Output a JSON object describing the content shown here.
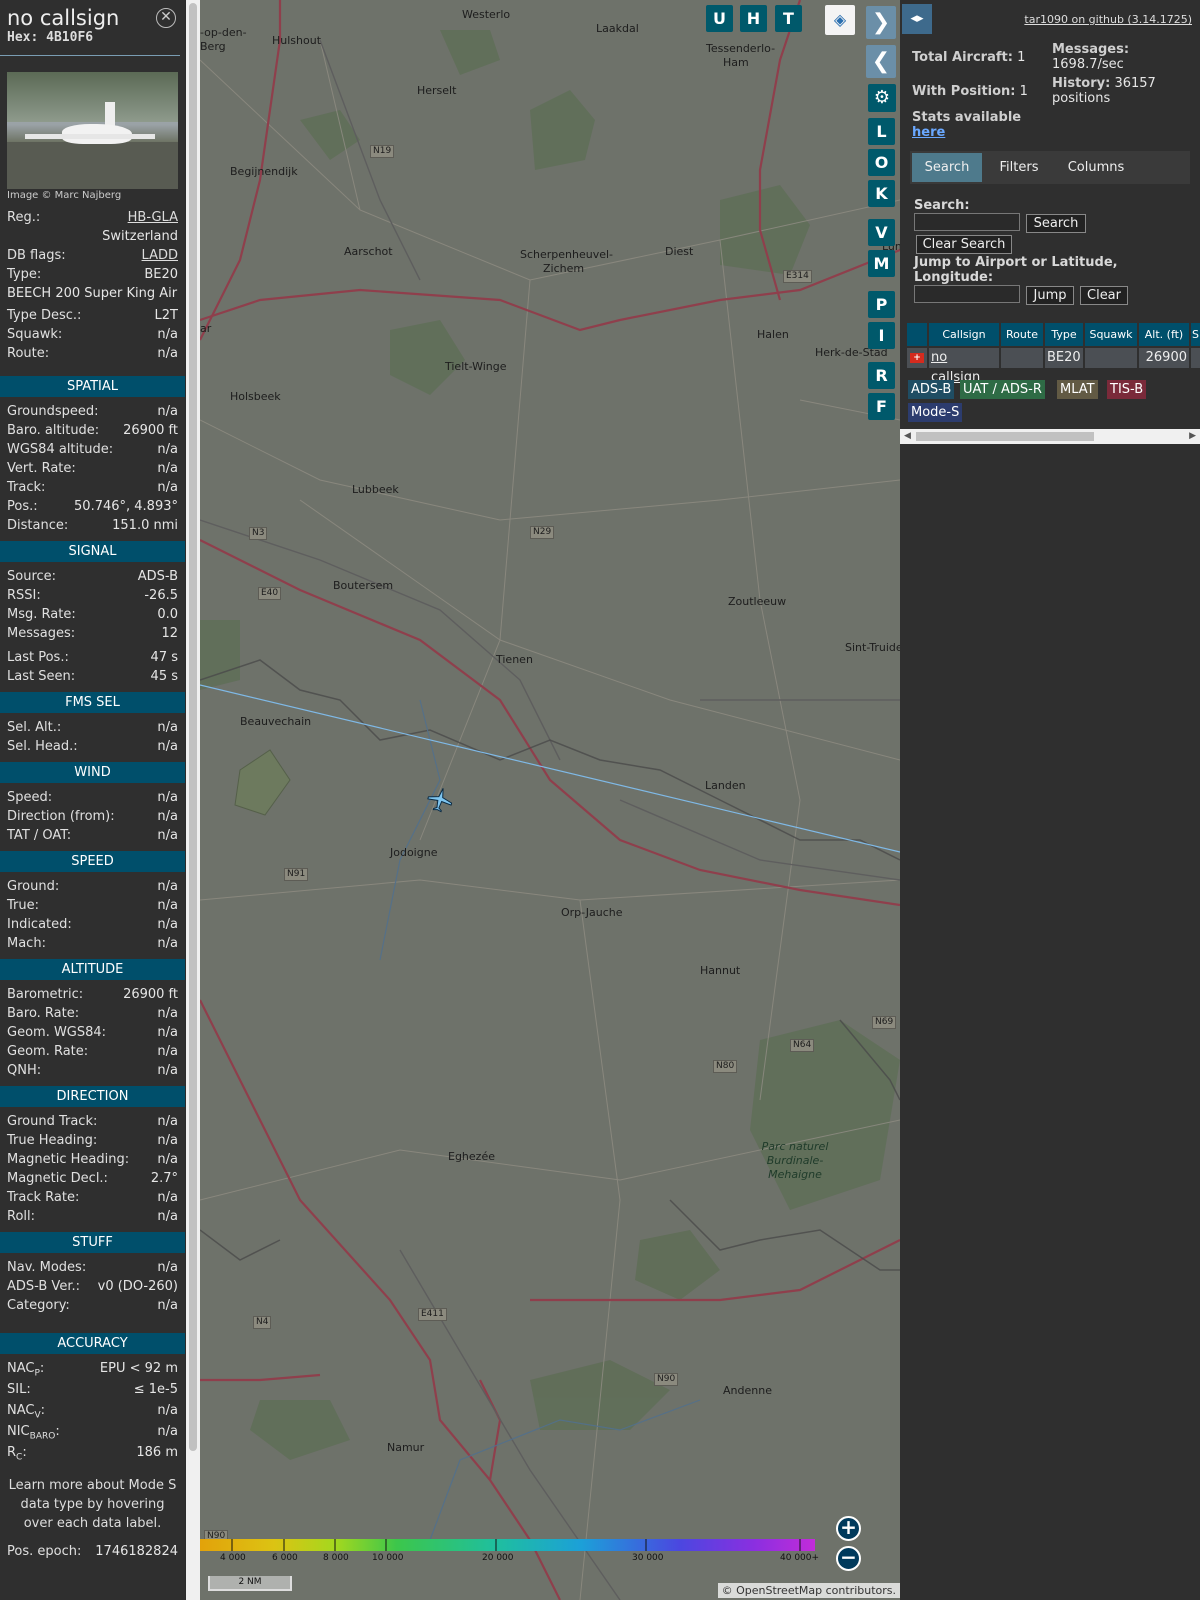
{
  "sidebar": {
    "callsign": "no callsign",
    "hex": "Hex: 4B10F6",
    "photo_credit": "Image © Marc Najberg",
    "reg_label": "Reg.:",
    "reg_value": "HB-GLA",
    "country": "Switzerland",
    "dbflags_label": "DB flags:",
    "dbflags_value": "LADD",
    "type_label": "Type:",
    "type_value": "BE20",
    "type_full": "BEECH 200 Super King Air",
    "typedesc_label": "Type Desc.:",
    "typedesc_value": "L2T",
    "squawk_label": "Squawk:",
    "squawk_value": "n/a",
    "route_label": "Route:",
    "route_value": "n/a",
    "sections": {
      "spatial": "SPATIAL",
      "signal": "SIGNAL",
      "fms": "FMS SEL",
      "wind": "WIND",
      "speed": "SPEED",
      "altitude": "ALTITUDE",
      "direction": "DIRECTION",
      "stuff": "STUFF",
      "accuracy": "ACCURACY"
    },
    "spatial": [
      {
        "k": "Groundspeed:",
        "v": "n/a"
      },
      {
        "k": "Baro. altitude:",
        "v": "26900 ft"
      },
      {
        "k": "WGS84 altitude:",
        "v": "n/a"
      },
      {
        "k": "Vert. Rate:",
        "v": "n/a"
      },
      {
        "k": "Track:",
        "v": "n/a"
      },
      {
        "k": "Pos.:",
        "v": "50.746°, 4.893°"
      },
      {
        "k": "Distance:",
        "v": "151.0 nmi"
      }
    ],
    "signal": [
      {
        "k": "Source:",
        "v": "ADS-B"
      },
      {
        "k": "RSSI:",
        "v": "-26.5"
      },
      {
        "k": "Msg. Rate:",
        "v": "0.0"
      },
      {
        "k": "Messages:",
        "v": "12"
      },
      {
        "k": "Last Pos.:",
        "v": "47 s"
      },
      {
        "k": "Last Seen:",
        "v": "45 s"
      }
    ],
    "fms": [
      {
        "k": "Sel. Alt.:",
        "v": "n/a"
      },
      {
        "k": "Sel. Head.:",
        "v": "n/a"
      }
    ],
    "wind": [
      {
        "k": "Speed:",
        "v": "n/a"
      },
      {
        "k": "Direction (from):",
        "v": "n/a"
      },
      {
        "k": "TAT / OAT:",
        "v": "n/a"
      }
    ],
    "speed": [
      {
        "k": "Ground:",
        "v": "n/a"
      },
      {
        "k": "True:",
        "v": "n/a"
      },
      {
        "k": "Indicated:",
        "v": "n/a"
      },
      {
        "k": "Mach:",
        "v": "n/a"
      }
    ],
    "altitude": [
      {
        "k": "Barometric:",
        "v": "26900 ft"
      },
      {
        "k": "Baro. Rate:",
        "v": "n/a"
      },
      {
        "k": "Geom. WGS84:",
        "v": "n/a"
      },
      {
        "k": "Geom. Rate:",
        "v": "n/a"
      },
      {
        "k": "QNH:",
        "v": "n/a"
      }
    ],
    "direction": [
      {
        "k": "Ground Track:",
        "v": "n/a"
      },
      {
        "k": "True Heading:",
        "v": "n/a"
      },
      {
        "k": "Magnetic Heading:",
        "v": "n/a"
      },
      {
        "k": "Magnetic Decl.:",
        "v": "2.7°"
      },
      {
        "k": "Track Rate:",
        "v": "n/a"
      },
      {
        "k": "Roll:",
        "v": "n/a"
      }
    ],
    "stuff": [
      {
        "k": "Nav. Modes:",
        "v": "n/a"
      },
      {
        "k": "ADS-B Ver.:",
        "v": "v0 (DO-260)"
      },
      {
        "k": "Category:",
        "v": "n/a"
      }
    ],
    "accuracy": [
      {
        "k": "NACP:",
        "v": "EPU < 92 m"
      },
      {
        "k": "SIL:",
        "v": "≤ 1e-5"
      },
      {
        "k": "NACV:",
        "v": "n/a"
      },
      {
        "k": "NICBARO:",
        "v": "n/a"
      },
      {
        "k": "RC:",
        "v": "186 m"
      }
    ],
    "learn_more": "Learn more about Mode S data type by hovering over each data label.",
    "pos_epoch_label": "Pos. epoch:",
    "pos_epoch_value": "1746182824"
  },
  "map": {
    "buttons_top": [
      "U",
      "H",
      "T"
    ],
    "buttons_side": [
      "L",
      "O",
      "K",
      "V",
      "M",
      "P",
      "I",
      "R",
      "F"
    ],
    "places": [
      {
        "name": "Westerlo"
      },
      {
        "name": "Laakdal"
      },
      {
        "name": "-op-den-"
      },
      {
        "name": "Berg"
      },
      {
        "name": "Hulshout"
      },
      {
        "name": "Tessenderlo-"
      },
      {
        "name": "Ham"
      },
      {
        "name": "Herselt"
      },
      {
        "name": "Begijnendijk"
      },
      {
        "name": "Aarschot"
      },
      {
        "name": "Scherpenheuvel-"
      },
      {
        "name": "Zichem"
      },
      {
        "name": "Diest"
      },
      {
        "name": "Halen"
      },
      {
        "name": "Herk-de-Stad"
      },
      {
        "name": "Tielt-Winge"
      },
      {
        "name": "Holsbeek"
      },
      {
        "name": "Lubbeek"
      },
      {
        "name": "Boutersem"
      },
      {
        "name": "Zoutleeuw"
      },
      {
        "name": "Tienen"
      },
      {
        "name": "Sint-Truide"
      },
      {
        "name": "Beauvechain"
      },
      {
        "name": "Landen"
      },
      {
        "name": "Jodoigne"
      },
      {
        "name": "Orp-Jauche"
      },
      {
        "name": "Hannut"
      },
      {
        "name": "Eghezée"
      },
      {
        "name": "Namur"
      },
      {
        "name": "Andenne"
      },
      {
        "name": "Lumme"
      },
      {
        "name": "ar"
      }
    ],
    "park": [
      "Parc naturel",
      "Burdinale-",
      "Mehaigne"
    ],
    "shields": [
      "N19",
      "E314",
      "N3",
      "N29",
      "E40",
      "N91",
      "N69",
      "N64",
      "N80",
      "E411",
      "N4",
      "N90",
      "N90"
    ],
    "legend_labels": [
      "4 000",
      "6 000",
      "8 000",
      "10 000",
      "20 000",
      "30 000",
      "40 000+"
    ],
    "scale": "2 NM",
    "attribution": "© OpenStreetMap contributors.",
    "zoom_in": "+",
    "zoom_out": "−"
  },
  "panel": {
    "github": "tar1090 on github (3.14.1725)",
    "total_label": "Total Aircraft:",
    "total_value": "1",
    "withpos_label": "With Position:",
    "withpos_value": "1",
    "messages_label": "Messages:",
    "messages_value": "1698.7/sec",
    "history_label": "History:",
    "history_value": "36157",
    "history_unit": "positions",
    "stats_text": "Stats available",
    "stats_link": "here",
    "tabs": [
      "Search",
      "Filters",
      "Columns"
    ],
    "search_label": "Search:",
    "search_button": "Search",
    "clear_search": "Clear Search",
    "jump_label": "Jump to Airport or Latitude, Longitude:",
    "jump_button": "Jump",
    "clear_button": "Clear",
    "table_headers": [
      "Callsign",
      "Route",
      "Type",
      "Squawk",
      "Alt. (ft)",
      "S"
    ],
    "table_row": {
      "callsign": "no callsign",
      "route": "",
      "type": "BE20",
      "squawk": "",
      "alt": "26900"
    },
    "badges": [
      {
        "label": "ADS-B",
        "color": "#1f4d63"
      },
      {
        "label": "UAT / ADS-R",
        "color": "#2e6b45"
      },
      {
        "label": "MLAT",
        "color": "#625a44"
      },
      {
        "label": "TIS-B",
        "color": "#7a2a3a"
      },
      {
        "label": "Mode-S",
        "color": "#2c3c6e"
      }
    ]
  }
}
